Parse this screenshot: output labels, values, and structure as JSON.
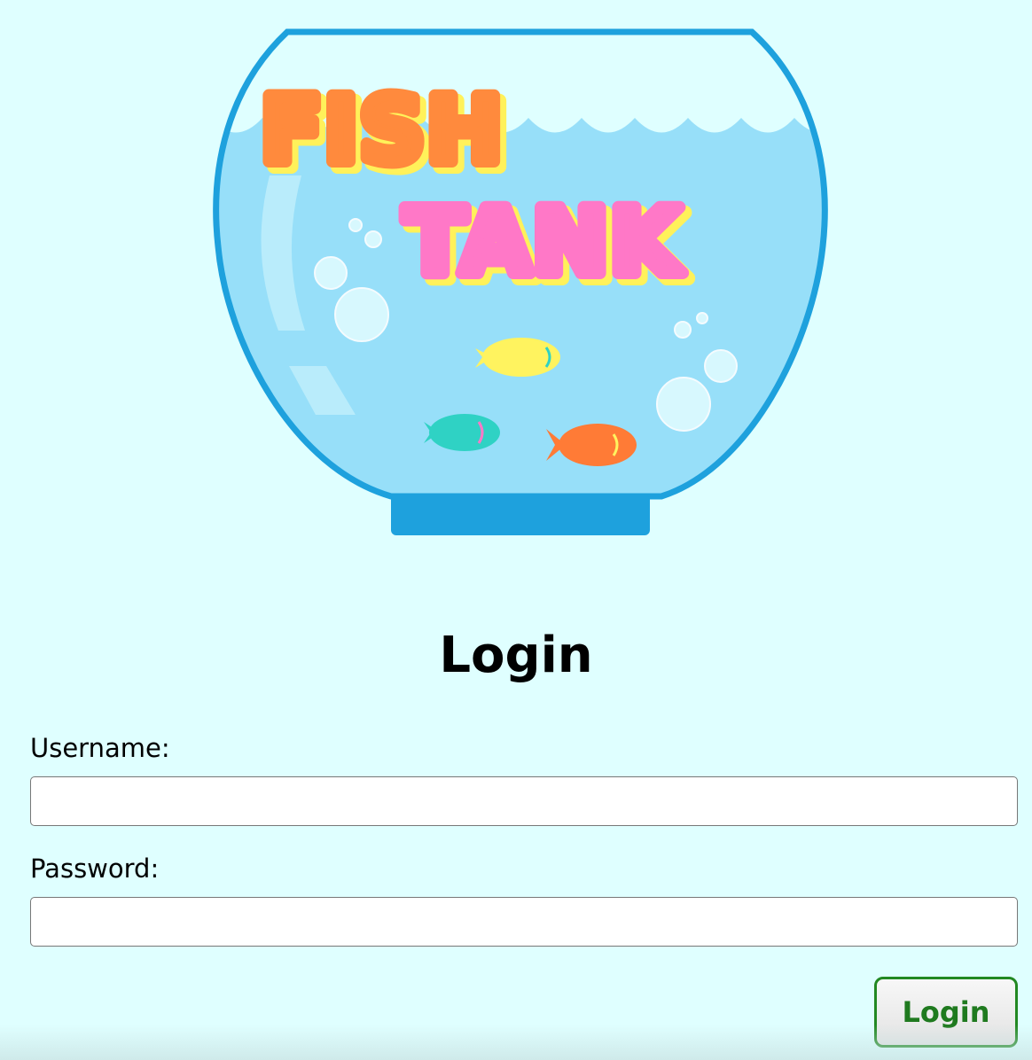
{
  "logo": {
    "word1": "FISH",
    "word2": "TANK",
    "colors": {
      "bowl_outline": "#1ea1dd",
      "water": "#97dff9",
      "word1_fill": "#ff8a3d",
      "word2_fill": "#ff78c7",
      "text_shadow": "#fff15a",
      "fish_yellow": "#fff35f",
      "fish_teal": "#2fd2c4",
      "fish_orange": "#ff7b36"
    }
  },
  "page": {
    "title": "Login"
  },
  "form": {
    "username_label": "Username:",
    "username_value": "",
    "username_placeholder": "",
    "password_label": "Password:",
    "password_value": "",
    "password_placeholder": "",
    "submit_label": "Login"
  },
  "colors": {
    "background": "#dfffff",
    "button_text": "#1f7a1f",
    "button_border": "#228822"
  }
}
